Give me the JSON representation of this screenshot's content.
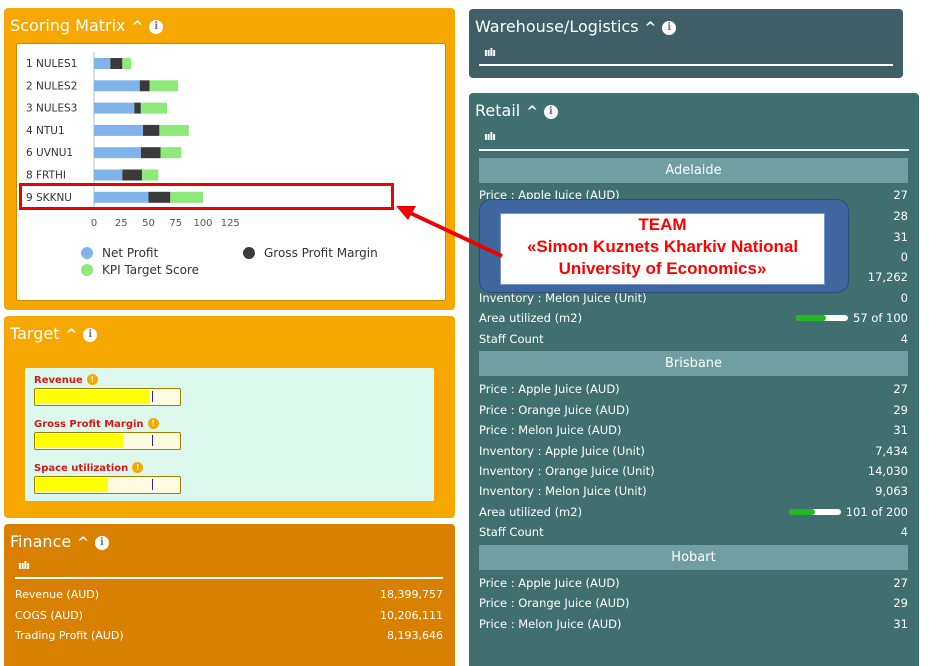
{
  "scoring": {
    "title": "Scoring Matrix",
    "chart_data": {
      "type": "bar",
      "orientation": "horizontal",
      "stacked": true,
      "categories": [
        "1 NULES1",
        "2 NULES2",
        "3 NULES3",
        "4 NTU1",
        "6 UVNU1",
        "8 FRTHI",
        "9 SKKNU"
      ],
      "series": [
        {
          "name": "Net Profit",
          "color": "#7fb3ea",
          "values": [
            15,
            42,
            37,
            45,
            43,
            26,
            50
          ]
        },
        {
          "name": "Gross Profit Margin",
          "color": "#3a3a3a",
          "values": [
            11,
            9,
            6,
            15,
            18,
            18,
            20
          ]
        },
        {
          "name": "KPI Target Score",
          "color": "#8ee87a",
          "values": [
            8,
            26,
            24,
            27,
            19,
            15,
            30
          ]
        }
      ],
      "xticks": [
        "0",
        "25",
        "50",
        "75",
        "100",
        "125"
      ],
      "xlim": [
        0,
        125
      ],
      "legend_position": "bottom"
    }
  },
  "target": {
    "title": "Target",
    "items": [
      {
        "label": "Revenue",
        "fill": 0.8,
        "target": 0.82
      },
      {
        "label": "Gross Profit Margin",
        "fill": 0.61,
        "target": 0.82
      },
      {
        "label": "Space utilization",
        "fill": 0.5,
        "target": 0.82
      }
    ]
  },
  "finance": {
    "title": "Finance",
    "rows": [
      {
        "label": "Revenue (AUD)",
        "value": "18,399,757"
      },
      {
        "label": "COGS (AUD)",
        "value": "10,206,111"
      },
      {
        "label": "Trading Profit (AUD)",
        "value": "8,193,646"
      }
    ]
  },
  "warehouse": {
    "title": "Warehouse/Logistics"
  },
  "retail": {
    "title": "Retail",
    "cities": [
      {
        "name": "Adelaide",
        "rows": [
          {
            "label": "Price : Apple Juice (AUD)",
            "value": "27"
          },
          {
            "label": "",
            "value": "28"
          },
          {
            "label": "",
            "value": "31"
          },
          {
            "label": "",
            "value": "0"
          },
          {
            "label": "",
            "value": "17,262"
          },
          {
            "label": "Inventory : Melon Juice (Unit)",
            "value": "0"
          }
        ],
        "area": {
          "label": "Area utilized (m2)",
          "value": "57 of 100",
          "fill": 0.57
        },
        "staff": {
          "label": "Staff Count",
          "value": "4"
        }
      },
      {
        "name": "Brisbane",
        "rows": [
          {
            "label": "Price : Apple Juice (AUD)",
            "value": "27"
          },
          {
            "label": "Price : Orange Juice (AUD)",
            "value": "29"
          },
          {
            "label": "Price : Melon Juice (AUD)",
            "value": "31"
          },
          {
            "label": "Inventory : Apple Juice (Unit)",
            "value": "7,434"
          },
          {
            "label": "Inventory : Orange Juice (Unit)",
            "value": "14,030"
          },
          {
            "label": "Inventory : Melon Juice (Unit)",
            "value": "9,063"
          }
        ],
        "area": {
          "label": "Area utilized (m2)",
          "value": "101 of 200",
          "fill": 0.505
        },
        "staff": {
          "label": "Staff Count",
          "value": "4"
        }
      },
      {
        "name": "Hobart",
        "rows": [
          {
            "label": "Price : Apple Juice (AUD)",
            "value": "27"
          },
          {
            "label": "Price : Orange Juice (AUD)",
            "value": "29"
          },
          {
            "label": "Price : Melon Juice (AUD)",
            "value": "31"
          }
        ]
      }
    ]
  },
  "team": {
    "line1": "TEAM",
    "line2": "«Simon Kuznets Kharkiv National",
    "line3": "University of Economics»"
  },
  "icons": {
    "collapse": "chevron-up-icon",
    "info": "info-icon",
    "chart": "bar-chart-icon"
  },
  "colors": {
    "scoring_bg": "#f7a800",
    "finance_bg": "#d98000",
    "retail_bg": "#3f6f6e",
    "highlight": "#ee0000"
  }
}
